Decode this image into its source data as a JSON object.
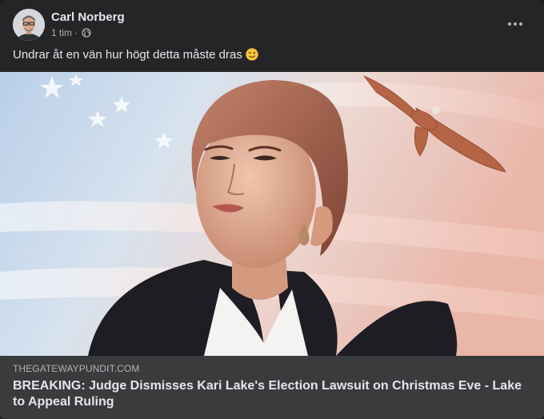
{
  "post": {
    "author": "Carl Norberg",
    "time": "1 tim",
    "separator": "·",
    "privacy_icon": "globe-icon",
    "text": "Undrar åt en vän hur högt detta måste dras",
    "emoji": "winking-face-emoji"
  },
  "link_preview": {
    "domain": "THEGATEWAYPUNDIT.COM",
    "headline": "BREAKING: Judge Dismisses Kari Lake's Election Lawsuit on Christmas Eve - Lake to Appeal Ruling"
  },
  "colors": {
    "card_bg": "#242526",
    "link_bg": "#3a3b3c",
    "text_primary": "#e4e6eb",
    "text_secondary": "#b0b3b8"
  }
}
